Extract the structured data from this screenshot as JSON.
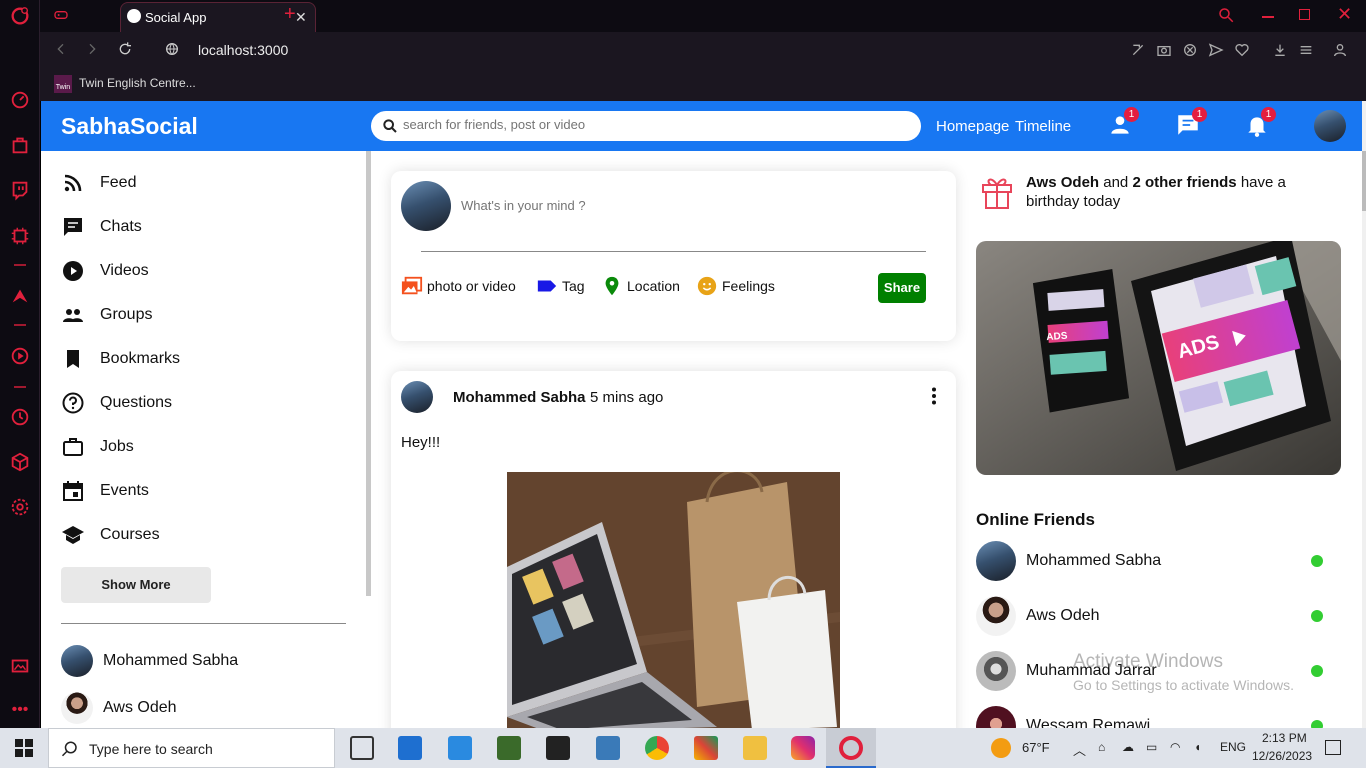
{
  "browser": {
    "tab_title": "Social App",
    "url": "localhost:3000",
    "bookmark": "Twin English Centre...",
    "bookmark_icon_text": "Twin",
    "new_tab": "+",
    "close_tab": "✕"
  },
  "header": {
    "logo": "SabhaSocial",
    "search_placeholder": "search for friends, post or video",
    "links": [
      "Homepage",
      "Timeline"
    ],
    "badges": {
      "friends": "1",
      "messages": "1",
      "notifications": "1"
    }
  },
  "sidebar": {
    "items": [
      {
        "label": "Feed",
        "icon": "rss-icon"
      },
      {
        "label": "Chats",
        "icon": "chat-icon"
      },
      {
        "label": "Videos",
        "icon": "play-circle-icon"
      },
      {
        "label": "Groups",
        "icon": "group-icon"
      },
      {
        "label": "Bookmarks",
        "icon": "bookmark-icon"
      },
      {
        "label": "Questions",
        "icon": "help-circle-icon"
      },
      {
        "label": "Jobs",
        "icon": "briefcase-icon"
      },
      {
        "label": "Events",
        "icon": "calendar-icon"
      },
      {
        "label": "Courses",
        "icon": "school-icon"
      }
    ],
    "show_more": "Show More",
    "friends": [
      "Mohammed Sabha",
      "Aws Odeh"
    ]
  },
  "composer": {
    "placeholder": "What's in your mind ?",
    "options": [
      "photo or video",
      "Tag",
      "Location",
      "Feelings"
    ],
    "share": "Share"
  },
  "post": {
    "author": "Mohammed Sabha",
    "time": "5 mins ago",
    "text": "Hey!!!"
  },
  "rightbar": {
    "birthday_name": "Aws Odeh",
    "birthday_and": "and",
    "birthday_others": "2 other friends",
    "birthday_rest": "have a birthday today",
    "ad_text": "ADS",
    "online_title": "Online Friends",
    "online": [
      "Mohammed Sabha",
      "Aws Odeh",
      "Muhammad Jarrar",
      "Wessam Remawi"
    ]
  },
  "watermark": {
    "line1": "Activate Windows",
    "line2": "Go to Settings to activate Windows."
  },
  "taskbar": {
    "search_placeholder": "Type here to search",
    "weather": "67°F",
    "language": "ENG",
    "time": "2:13 PM",
    "date": "12/26/2023"
  },
  "colors": {
    "brand": "#1877f2",
    "share_button": "#008000",
    "badge": "#e41e3f",
    "online": "#32cd32",
    "opera_accent": "#e0203c"
  }
}
